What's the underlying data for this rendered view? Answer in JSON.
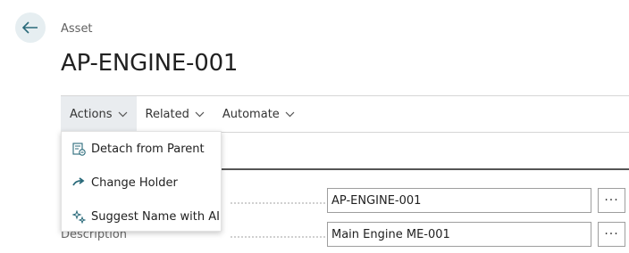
{
  "header": {
    "breadcrumb": "Asset",
    "title": "AP-ENGINE-001"
  },
  "actionbar": {
    "items": [
      {
        "label": "Actions"
      },
      {
        "label": "Related"
      },
      {
        "label": "Automate"
      }
    ]
  },
  "actions_menu": {
    "items": [
      {
        "label": "Detach from Parent",
        "icon": "detach-icon"
      },
      {
        "label": "Change Holder",
        "icon": "arrow-right-icon"
      },
      {
        "label": "Suggest Name with AI",
        "icon": "sparkle-icon"
      }
    ]
  },
  "fields": [
    {
      "label": "",
      "value": "AP-ENGINE-001",
      "button": "···"
    },
    {
      "label": "Description",
      "value": "Main Engine ME-001",
      "button": "···"
    }
  ],
  "colors": {
    "accent": "#0e6e7e",
    "back_button_bg": "#e6eef1"
  }
}
